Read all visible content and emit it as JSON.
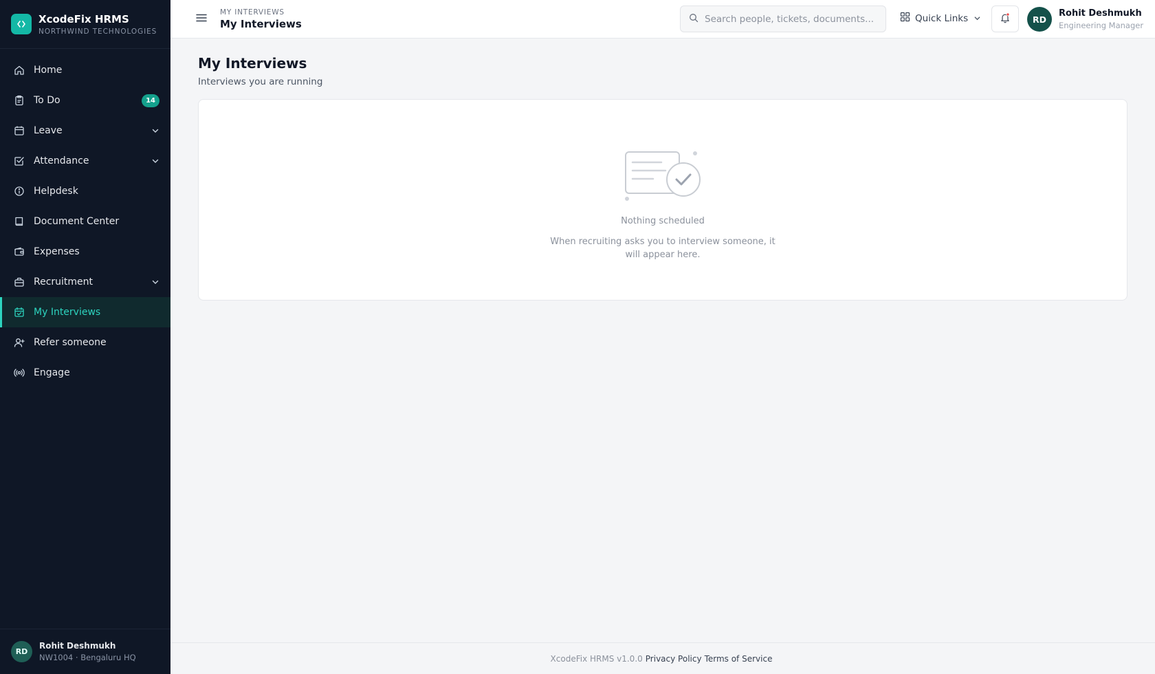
{
  "brand": {
    "name": "XcodeFix HRMS",
    "org": "NORTHWIND TECHNOLOGIES"
  },
  "sidebar": {
    "items": [
      {
        "label": "Home",
        "icon": "home-icon"
      },
      {
        "label": "To Do",
        "icon": "clipboard-icon",
        "badge": "14"
      },
      {
        "label": "Leave",
        "icon": "calendar-icon",
        "expandable": true
      },
      {
        "label": "Attendance",
        "icon": "check-square-icon",
        "expandable": true
      },
      {
        "label": "Helpdesk",
        "icon": "info-icon"
      },
      {
        "label": "Document Center",
        "icon": "book-icon"
      },
      {
        "label": "Expenses",
        "icon": "wallet-icon"
      },
      {
        "label": "Recruitment",
        "icon": "briefcase-icon",
        "expandable": true
      },
      {
        "label": "My Interviews",
        "icon": "calendar-check-icon",
        "active": true
      },
      {
        "label": "Refer someone",
        "icon": "user-plus-icon"
      },
      {
        "label": "Engage",
        "icon": "broadcast-icon"
      }
    ],
    "footer": {
      "initials": "RD",
      "name": "Rohit Deshmukh",
      "meta": "NW1004 · Bengaluru HQ"
    }
  },
  "header": {
    "breadcrumb": "MY INTERVIEWS",
    "title": "My Interviews",
    "search_placeholder": "Search people, tickets, documents...",
    "quick_links": "Quick Links",
    "user": {
      "initials": "RD",
      "name": "Rohit Deshmukh",
      "role": "Engineering Manager"
    }
  },
  "main": {
    "title": "My Interviews",
    "subtitle": "Interviews you are running",
    "empty": {
      "title": "Nothing scheduled",
      "description": "When recruiting asks you to interview someone, it will appear here."
    }
  },
  "footer": {
    "version": "XcodeFix HRMS v1.0.0",
    "privacy": "Privacy Policy",
    "terms": "Terms of Service"
  },
  "colors": {
    "accent": "#14b8a6",
    "sidebar_bg": "#0f1726",
    "active_text": "#2dd4bf",
    "badge": "#14a08c"
  }
}
